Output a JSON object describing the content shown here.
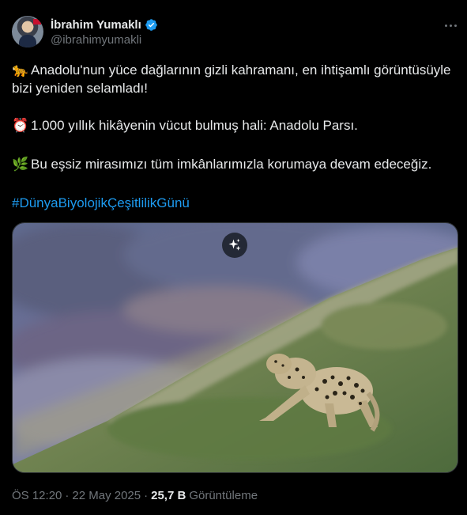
{
  "author": {
    "name": "İbrahim Yumaklı",
    "handle": "@ibrahimyumakli",
    "verified_color": "#1d9bf0"
  },
  "tweet": {
    "paragraphs": [
      {
        "emoji": "🐆",
        "emoji_icon": "leopard-emoji",
        "text": "Anadolu'nun yüce dağlarının gizli kahramanı, en ihtişamlı görüntüsüyle bizi yeniden selamladı!"
      },
      {
        "emoji": "⏰",
        "emoji_icon": "alarm-clock-emoji",
        "text": "1.000 yıllık hikâyenin vücut bulmuş hali: Anadolu Parsı."
      },
      {
        "emoji": "🌿",
        "emoji_icon": "herb-emoji",
        "text": "Bu eşsiz mirasımızı tüm imkânlarımızla korumaya devam edeceğiz."
      }
    ],
    "hashtag": "#DünyaBiyolojikÇeşitlilikGünü",
    "media_icon": "sparkle-icon"
  },
  "meta": {
    "time": "ÖS 12:20",
    "separator": "·",
    "date": "22 May 2025",
    "views_count": "25,7 B",
    "views_label": "Görüntüleme"
  },
  "colors": {
    "background": "#000000",
    "text": "#e7e9ea",
    "muted": "#71767b",
    "link": "#1d9bf0"
  }
}
